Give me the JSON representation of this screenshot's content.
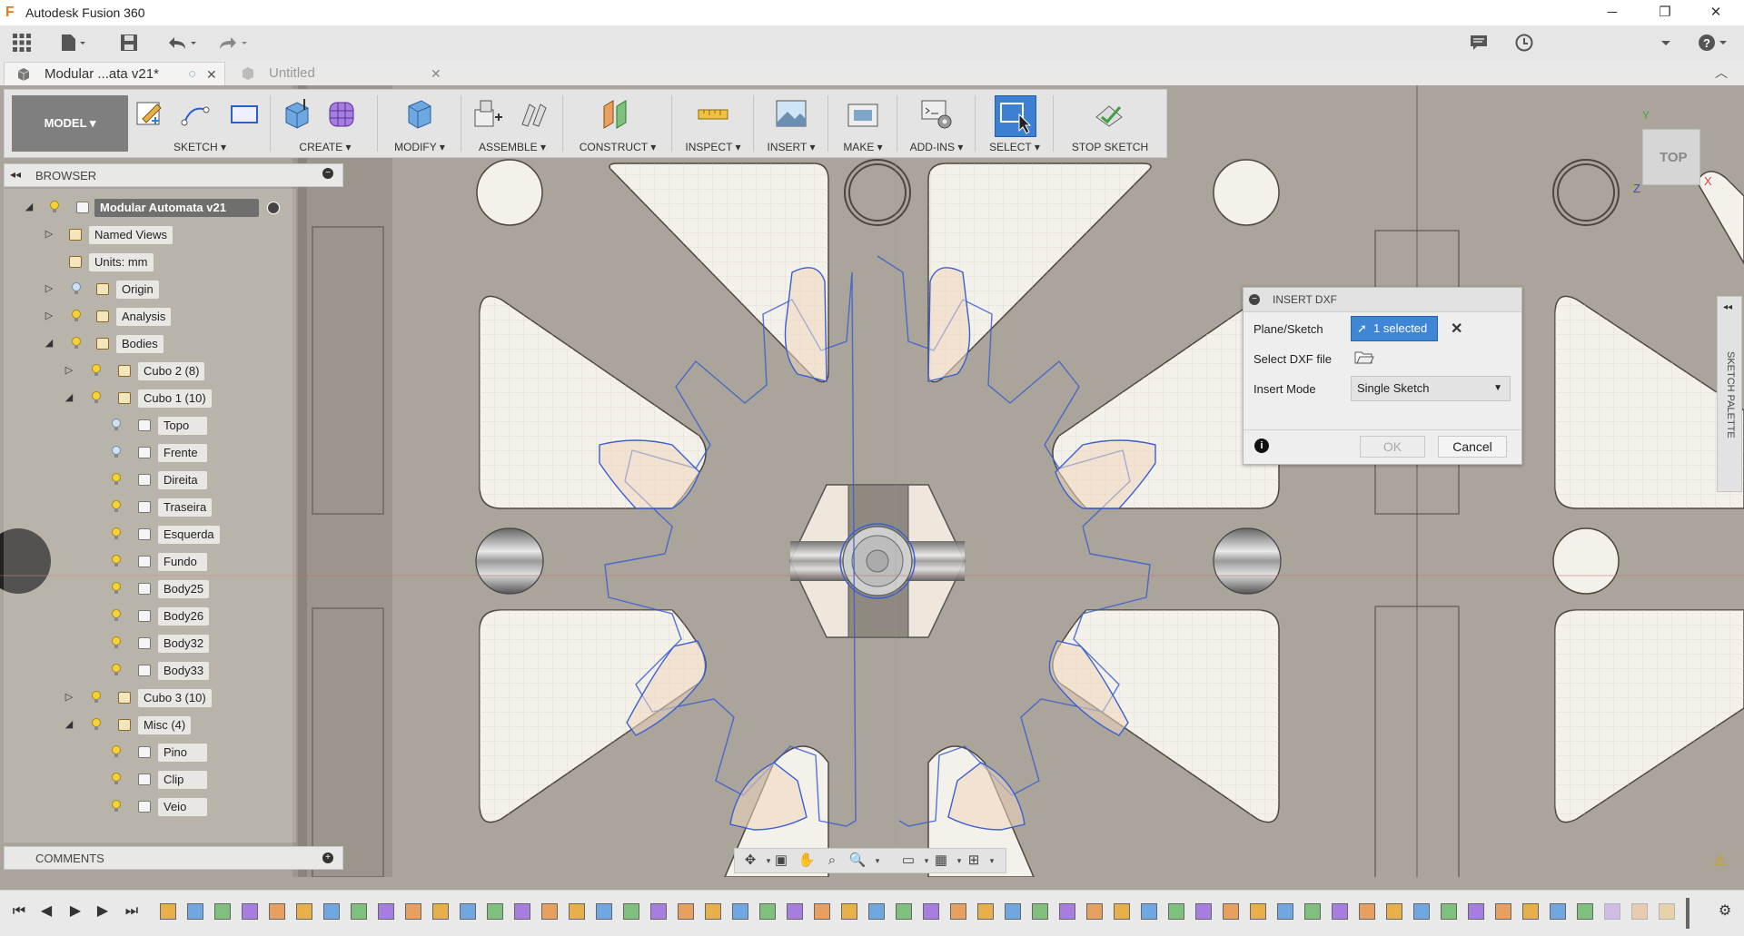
{
  "window": {
    "title": "Autodesk Fusion 360",
    "logo_letter": "F",
    "minimize": "─",
    "restore": "❐",
    "close": "✕"
  },
  "tabs": [
    {
      "label": "Modular ...ata v21*"
    },
    {
      "label": "Untitled"
    }
  ],
  "toolbar": {
    "workspace": "MODEL",
    "groups": {
      "sketch": "SKETCH",
      "create": "CREATE",
      "modify": "MODIFY",
      "assemble": "ASSEMBLE",
      "construct": "CONSTRUCT",
      "inspect": "INSPECT",
      "insert": "INSERT",
      "make": "MAKE",
      "addins": "ADD-INS",
      "select": "SELECT",
      "stop_sketch": "STOP SKETCH"
    }
  },
  "browser": {
    "title": "BROWSER",
    "root": "Modular Automata v21",
    "named_views": "Named Views",
    "units": "Units: mm",
    "origin": "Origin",
    "analysis": "Analysis",
    "bodies": "Bodies",
    "cubo2": "Cubo 2 (8)",
    "cubo1": "Cubo 1 (10)",
    "cubo1_items": [
      "Topo",
      "Frente",
      "Direita",
      "Traseira",
      "Esquerda",
      "Fundo",
      "Body25",
      "Body26",
      "Body32",
      "Body33"
    ],
    "cubo3": "Cubo 3 (10)",
    "misc": "Misc (4)",
    "misc_items": [
      "Pino",
      "Clip",
      "Veio"
    ]
  },
  "comments": {
    "title": "COMMENTS"
  },
  "dialog": {
    "title": "INSERT DXF",
    "plane_label": "Plane/Sketch",
    "plane_value": "1 selected",
    "file_label": "Select DXF file",
    "mode_label": "Insert Mode",
    "mode_value": "Single Sketch",
    "ok": "OK",
    "cancel": "Cancel"
  },
  "viewcube": {
    "face": "TOP",
    "x_axis": "X",
    "y_axis": "Y",
    "z_axis": "Z"
  },
  "sketch_palette": {
    "label": "SKETCH PALETTE"
  },
  "colors": {
    "accent": "#4f8fd6",
    "sketch_line": "#3a5fd0",
    "canvas": "#aaa49a",
    "hole": "#f4f0ea"
  }
}
